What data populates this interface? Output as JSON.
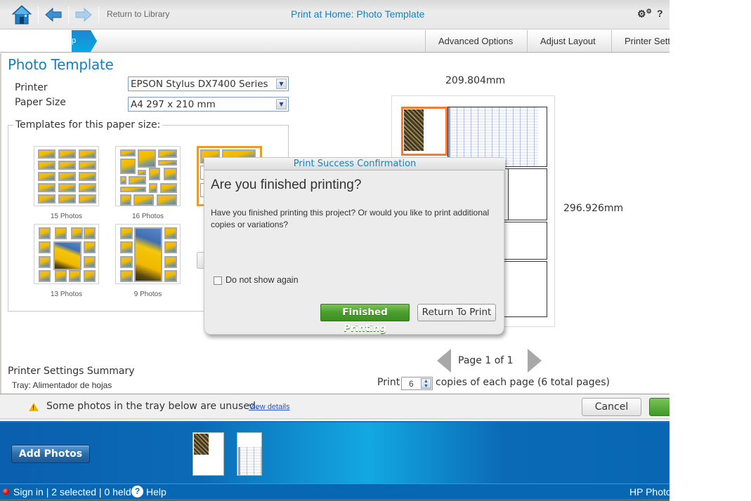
{
  "toolbar": {
    "home_icon": "home-icon",
    "back_icon": "arrow-left-icon",
    "forward_icon": "arrow-right-icon",
    "return_label": "Return to Library",
    "title": "Print at Home: Photo Template",
    "settings_icon": "gears-icon",
    "help_label": "?"
  },
  "steps": {
    "current_partial": "p"
  },
  "tabs": [
    {
      "label": "Advanced Options"
    },
    {
      "label": "Adjust Layout"
    },
    {
      "label": "Printer Sett"
    }
  ],
  "panel": {
    "title": "Photo Template",
    "printer_label": "Printer",
    "printer_value": "EPSON Stylus DX7400 Series",
    "paper_label": "Paper Size",
    "paper_value": "A4 297 x 210 mm",
    "templates_label": "Templates for this paper size:",
    "templates": [
      {
        "caption": "15 Photos"
      },
      {
        "caption": "16 Photos"
      },
      {
        "caption": "",
        "selected": true
      },
      {
        "caption": "13 Photos"
      },
      {
        "caption": "9 Photos"
      }
    ],
    "summary_title": "Printer Settings Summary",
    "tray_text": "Tray:  Alimentador de hojas"
  },
  "preview": {
    "width_label": "209.804mm",
    "height_label": "296.926mm",
    "page_label": "Page   1 of   1",
    "print_label": "Print",
    "copies_value": "6",
    "copies_suffix": "copies of each page (6 total pages)"
  },
  "warning": {
    "icon": "warning-icon",
    "text": "Some photos in the tray below are unused.",
    "link": "View details",
    "cancel_label": "Cancel"
  },
  "tray": {
    "add_photos_label": "Add Photos",
    "photo_count": 2
  },
  "status": {
    "text": "Sign in | 2 selected | 0 held",
    "help_label": "Help",
    "brand": "HP Photo"
  },
  "dialog": {
    "title": "Print Success Confirmation",
    "heading": "Are you finished printing?",
    "body": "Have you finished printing this project? Or would you like to print additional copies or variations?",
    "checkbox_label": "Do not show again",
    "checkbox_checked": false,
    "primary_label": "Finished Printing",
    "secondary_label": "Return To Print"
  },
  "colors": {
    "accent_blue": "#1a7fb8",
    "selection_orange": "#ee9a2a",
    "primary_green": "#4a9e2c",
    "tray_blue": "#0867b3"
  }
}
